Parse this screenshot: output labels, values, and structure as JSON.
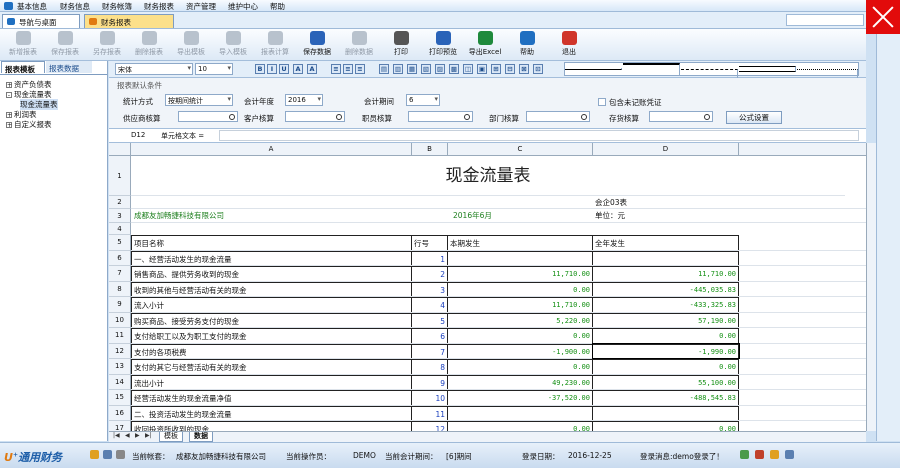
{
  "menu": [
    "基本信息",
    "财务信息",
    "财务帐簿",
    "财务报表",
    "资产管理",
    "维护中心",
    "帮助"
  ],
  "tabs": {
    "nav": "导航与桌面",
    "report": "财务报表"
  },
  "toolbar": [
    {
      "label": "新增报表",
      "state": "disabled",
      "icon": "add-report-icon"
    },
    {
      "label": "保存报表",
      "state": "disabled",
      "icon": "save-report-icon"
    },
    {
      "label": "另存报表",
      "state": "disabled",
      "icon": "save-as-icon"
    },
    {
      "label": "删除报表",
      "state": "disabled",
      "icon": "delete-report-icon"
    },
    {
      "label": "导出模板",
      "state": "disabled",
      "icon": "export-template-icon"
    },
    {
      "label": "导入模板",
      "state": "disabled",
      "icon": "import-template-icon"
    },
    {
      "label": "报表计算",
      "state": "disabled",
      "icon": "calculate-icon"
    },
    {
      "label": "保存数据",
      "state": "enabled",
      "icon": "save-data-icon"
    },
    {
      "label": "删除数据",
      "state": "disabled",
      "icon": "delete-data-icon"
    },
    {
      "label": "打印",
      "state": "enabled",
      "icon": "print-icon"
    },
    {
      "label": "打印预览",
      "state": "enabled",
      "icon": "print-preview-icon"
    },
    {
      "label": "导出Excel",
      "state": "enabled",
      "icon": "excel-icon"
    },
    {
      "label": "帮助",
      "state": "enabled",
      "icon": "help-icon"
    },
    {
      "label": "退出",
      "state": "enabled",
      "icon": "exit-icon"
    }
  ],
  "left_tabs": {
    "template": "报表模板",
    "data": "报表数据"
  },
  "tree": [
    {
      "label": "资产负债表",
      "level": 0,
      "expander": "+"
    },
    {
      "label": "现金流量表",
      "level": 0,
      "expander": "-"
    },
    {
      "label": "现金流量表",
      "level": 1,
      "expander": "",
      "selected": true
    },
    {
      "label": "利润表",
      "level": 0,
      "expander": "+"
    },
    {
      "label": "自定义报表",
      "level": 0,
      "expander": "+"
    }
  ],
  "format": {
    "font": "宋体",
    "size": "10",
    "buttons": [
      "B",
      "I",
      "U",
      "A",
      "A",
      "≡",
      "≡",
      "≡",
      "▤",
      "▥",
      "▦",
      "▧",
      "▨",
      "▩",
      "◫",
      "▣",
      "⊞",
      "⊟",
      "⊠",
      "⊡",
      "▭",
      "▬"
    ]
  },
  "conditions": {
    "group_label": "报表默认条件",
    "stat_label": "统计方式",
    "stat_value": "按期间统计",
    "year_label": "会计年度",
    "year_value": "2016",
    "period_label": "会计期间",
    "period_value": "6",
    "include_label": "包含未记账凭证",
    "supplier_label": "供应商核算",
    "customer_label": "客户核算",
    "staff_label": "职员核算",
    "dept_label": "部门核算",
    "stock_label": "存货核算",
    "formula_btn": "公式设置"
  },
  "formula_bar": {
    "cell": "D12",
    "label": "单元格文本 ="
  },
  "columns": [
    "A",
    "B",
    "C",
    "D"
  ],
  "report": {
    "title": "现金流量表",
    "form_code": "会企03表",
    "company": "成都友加畅捷科技有限公司",
    "period": "2016年6月",
    "unit": "单位：元",
    "headers": [
      "项目名称",
      "行号",
      "本期发生",
      "全年发生"
    ],
    "rows": [
      {
        "n": "6",
        "name": "一、经营活动发生的现金流量",
        "line": "1",
        "cur": "",
        "year": ""
      },
      {
        "n": "7",
        "name": "    销售商品、提供劳务收到的现金",
        "line": "2",
        "cur": "11,710.00",
        "year": "11,710.00"
      },
      {
        "n": "8",
        "name": "    收到的其他与经营活动有关的现金",
        "line": "3",
        "cur": "0.00",
        "year": "-445,035.83"
      },
      {
        "n": "9",
        "name": "    流入小计",
        "line": "4",
        "cur": "11,710.00",
        "year": "-433,325.83"
      },
      {
        "n": "10",
        "name": "    购买商品、接受劳务支付的现金",
        "line": "5",
        "cur": "5,220.00",
        "year": "57,190.00"
      },
      {
        "n": "11",
        "name": "    支付给职工以及为职工支付的现金",
        "line": "6",
        "cur": "0.00",
        "year": "0.00"
      },
      {
        "n": "12",
        "name": "    支付的各项税费",
        "line": "7",
        "cur": "-1,900.00",
        "year": "-1,990.00"
      },
      {
        "n": "13",
        "name": "    支付的其它与经营活动有关的现金",
        "line": "8",
        "cur": "0.00",
        "year": "0.00"
      },
      {
        "n": "14",
        "name": "    流出小计",
        "line": "9",
        "cur": "49,230.00",
        "year": "55,100.00"
      },
      {
        "n": "15",
        "name": "经营活动发生的现金流量净值",
        "line": "10",
        "cur": "-37,520.00",
        "year": "-488,545.83"
      },
      {
        "n": "16",
        "name": "二、投资活动发生的现金流量",
        "line": "11",
        "cur": "",
        "year": ""
      },
      {
        "n": "17",
        "name": "    收回投资所收到的现金",
        "line": "12",
        "cur": "0.00",
        "year": "0.00"
      },
      {
        "n": "18",
        "name": "    取得投资收益所收到的现金",
        "line": "13",
        "cur": "0.00",
        "year": "0.00"
      },
      {
        "n": "19",
        "name": "    处置固定资产、无形资产和其他长期资产所收回的现金净额",
        "line": "14",
        "cur": "0.00",
        "year": "0.00"
      }
    ]
  },
  "sheet_tabs": [
    "模板",
    "数据"
  ],
  "status": {
    "logo": "通用财务",
    "account_label": "当前帐套：",
    "account": "成都友加畅捷科技有限公司",
    "operator_label": "当前操作员：",
    "operator": "DEMO",
    "period_label": "当前会计期间：",
    "period": "[6]期间",
    "login_label": "登录日期：",
    "login_date": "2016-12-25",
    "msg": "登录消息:demo登录了！"
  },
  "colors": {
    "accent": "#1f6fc1",
    "close": "#e20b0b",
    "active_tab": "#fce08a",
    "number": "#159015"
  }
}
